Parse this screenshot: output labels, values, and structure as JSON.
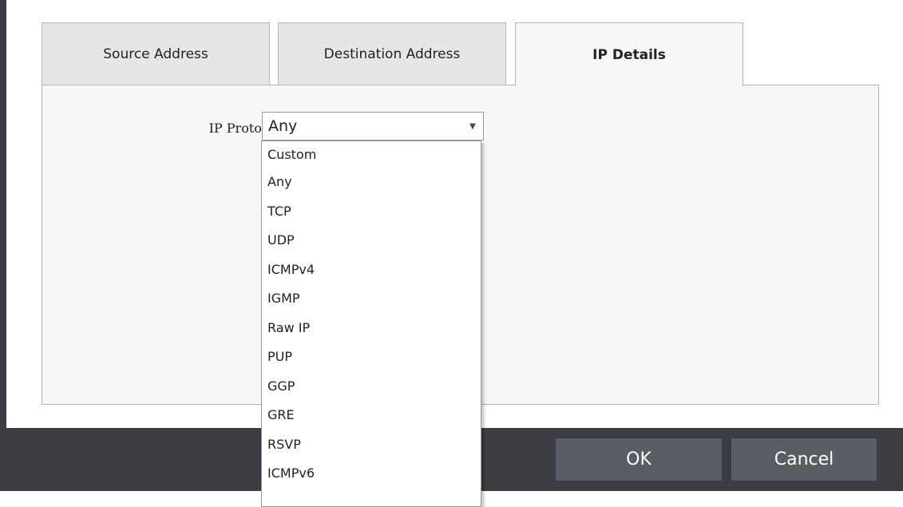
{
  "tabs": [
    {
      "label": "Source Address"
    },
    {
      "label": "Destination Address"
    },
    {
      "label": "IP Details"
    }
  ],
  "ip_details": {
    "protocol_label": "IP Protocol:",
    "protocol_selected": "Any",
    "protocol_options": [
      "Custom",
      "Any",
      "TCP",
      "UDP",
      "ICMPv4",
      "IGMP",
      "Raw IP",
      "PUP",
      "GGP",
      "GRE",
      "RSVP",
      "ICMPv6"
    ]
  },
  "footer": {
    "ok_label": "OK",
    "cancel_label": "Cancel"
  },
  "colors": {
    "frame": "#3b3d42",
    "button": "#5a5d63",
    "active_tab": "#f7f7f7",
    "inactive_tab": "#e6e6e6"
  }
}
